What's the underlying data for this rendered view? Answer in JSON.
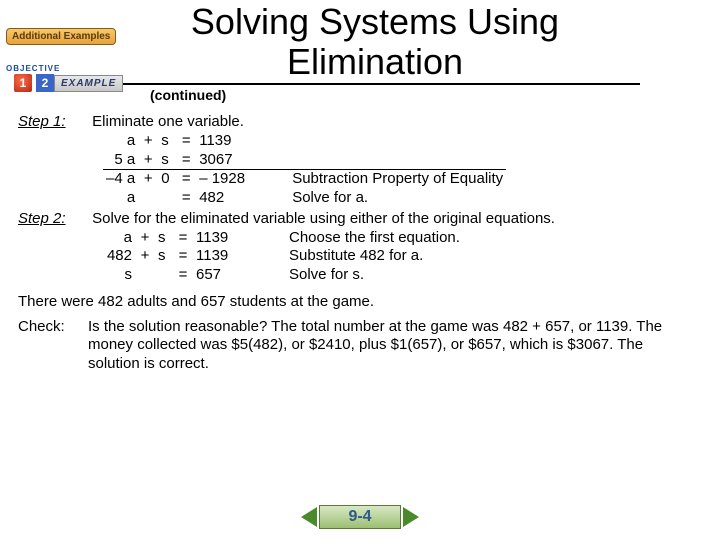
{
  "badges": {
    "additional_examples": "Additional Examples",
    "objective_label": "OBJECTIVE",
    "objective_num": "1",
    "example_num": "2",
    "example_word": "EXAMPLE"
  },
  "title": "Solving Systems Using Elimination",
  "continued": "(continued)",
  "step1": {
    "label": "Step 1:",
    "text": "Eliminate one variable.",
    "rows": [
      {
        "lhs": "a",
        "op": "+",
        "v2": "s",
        "eq": "=",
        "rhs": "1139",
        "note": ""
      },
      {
        "lhs": "5 a",
        "op": "+",
        "v2": "s",
        "eq": "=",
        "rhs": "3067",
        "note": ""
      },
      {
        "lhs": "–4 a",
        "op": "+",
        "v2": "0",
        "eq": "=",
        "rhs": "– 1928",
        "note": "Subtraction Property of Equality"
      },
      {
        "lhs": "a",
        "op": "",
        "v2": "",
        "eq": "=",
        "rhs": "482",
        "note": "Solve for a."
      }
    ]
  },
  "step2": {
    "label": "Step 2:",
    "text": "Solve for the eliminated variable using either of the original equations.",
    "rows": [
      {
        "lhs": "a",
        "op": "+",
        "v2": "s",
        "eq": "=",
        "rhs": "1139",
        "note": "Choose the first equation."
      },
      {
        "lhs": "482",
        "op": "+",
        "v2": "s",
        "eq": "=",
        "rhs": "1139",
        "note": "Substitute 482 for a."
      },
      {
        "lhs": "s",
        "op": "",
        "v2": "",
        "eq": "=",
        "rhs": "657",
        "note": "Solve for s."
      }
    ]
  },
  "summary": "There were 482 adults and 657 students at the game.",
  "check": {
    "label": "Check:",
    "text": "Is the solution reasonable? The total number at the game was 482 + 657, or 1139. The money collected was $5(482), or $2410, plus $1(657), or $657, which is $3067. The solution is correct."
  },
  "pager": {
    "section": "9-4"
  }
}
